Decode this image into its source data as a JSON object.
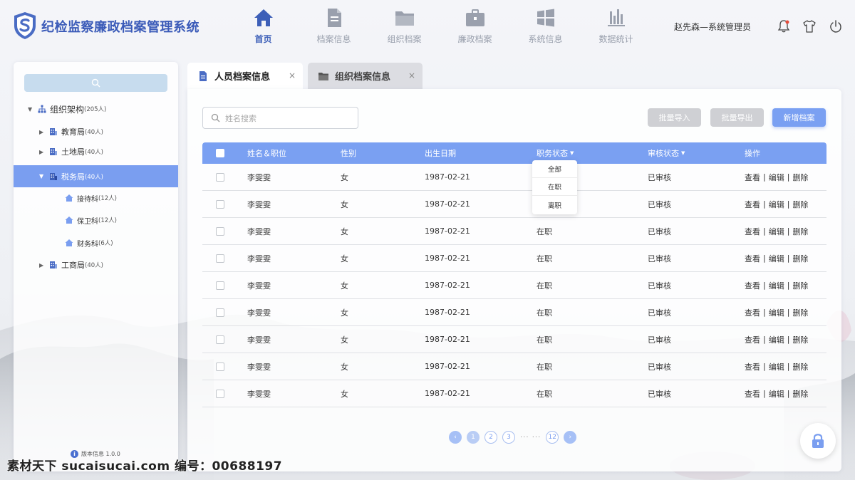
{
  "app": {
    "title": "纪检监察廉政档案管理系统"
  },
  "nav": [
    {
      "label": "首页",
      "icon": "home-icon",
      "active": true
    },
    {
      "label": "档案信息",
      "icon": "document-icon"
    },
    {
      "label": "组织档案",
      "icon": "folder-icon"
    },
    {
      "label": "廉政档案",
      "icon": "briefcase-icon"
    },
    {
      "label": "系统信息",
      "icon": "windows-icon"
    },
    {
      "label": "数据统计",
      "icon": "bar-chart-icon"
    }
  ],
  "user": {
    "name": "赵先森—系统管理员"
  },
  "sidebar": {
    "root": {
      "label": "组织架构",
      "count": "(205人)"
    },
    "items": [
      {
        "label": "教育局",
        "count": "(40人)"
      },
      {
        "label": "土地局",
        "count": "(40人)"
      },
      {
        "label": "税务局",
        "count": "(40人)",
        "selected": true
      },
      {
        "label": "接待科",
        "count": "(12人)"
      },
      {
        "label": "保卫科",
        "count": "(12人)"
      },
      {
        "label": "财务科",
        "count": "(6人)"
      },
      {
        "label": "工商局",
        "count": "(40人)"
      }
    ],
    "version": "版本信息 1.0.0"
  },
  "tabs": [
    {
      "label": "人员档案信息",
      "close": "×"
    },
    {
      "label": "组织档案信息",
      "close": "×"
    }
  ],
  "toolbar": {
    "search_placeholder": "姓名搜索",
    "import": "批量导入",
    "export": "批量导出",
    "add": "新增档案"
  },
  "table": {
    "headers": [
      "姓名＆职位",
      "性别",
      "出生日期",
      "职务状态",
      "审核状态",
      "操作"
    ],
    "rows": [
      {
        "name": "李雯雯",
        "gender": "女",
        "birth": "1987-02-21",
        "status": "",
        "audit": "已审核"
      },
      {
        "name": "李雯雯",
        "gender": "女",
        "birth": "1987-02-21",
        "status": "",
        "audit": "已审核"
      },
      {
        "name": "李雯雯",
        "gender": "女",
        "birth": "1987-02-21",
        "status": "在职",
        "audit": "已审核"
      },
      {
        "name": "李雯雯",
        "gender": "女",
        "birth": "1987-02-21",
        "status": "在职",
        "audit": "已审核"
      },
      {
        "name": "李雯雯",
        "gender": "女",
        "birth": "1987-02-21",
        "status": "在职",
        "audit": "已审核"
      },
      {
        "name": "李雯雯",
        "gender": "女",
        "birth": "1987-02-21",
        "status": "在职",
        "audit": "已审核"
      },
      {
        "name": "李雯雯",
        "gender": "女",
        "birth": "1987-02-21",
        "status": "在职",
        "audit": "已审核"
      },
      {
        "name": "李雯雯",
        "gender": "女",
        "birth": "1987-02-21",
        "status": "在职",
        "audit": "已审核"
      },
      {
        "name": "李雯雯",
        "gender": "女",
        "birth": "1987-02-21",
        "status": "在职",
        "audit": "已审核"
      }
    ],
    "ops": {
      "view": "查看",
      "edit": "编辑",
      "delete": "删除",
      "sep": "|"
    }
  },
  "dropdown": [
    "全部",
    "在职",
    "离职"
  ],
  "pagination": {
    "pages": [
      "1",
      "2",
      "3"
    ],
    "dots": "···  ···",
    "last": "12",
    "current": "1",
    "prev": "‹",
    "next": "›"
  },
  "watermark": "素材天下 sucaisucai.com  编号：00688197",
  "colors": {
    "primary": "#7aa0f2",
    "brand": "#3a5ab8",
    "header_active": "#3d5fb8"
  }
}
